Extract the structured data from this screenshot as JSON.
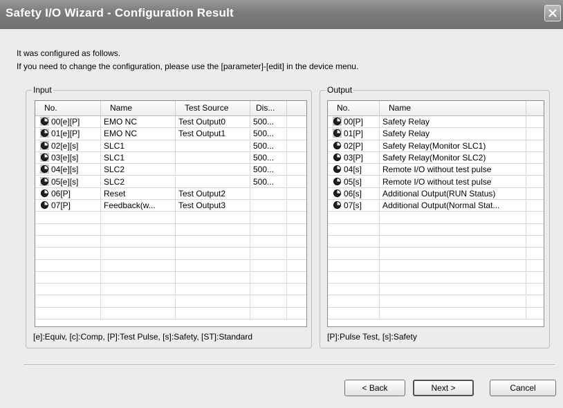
{
  "window": {
    "title": "Safety I/O Wizard - Configuration Result"
  },
  "intro": {
    "line1": "It was configured as follows.",
    "line2": "If you need to change the configuration, please use the [parameter]-[edit] in the device menu."
  },
  "input": {
    "group_label": "Input",
    "columns": [
      "No.",
      "Name",
      "Test Source",
      "Dis..."
    ],
    "rows": [
      {
        "no": "00[e][P]",
        "name": "EMO NC",
        "source": "Test Output0",
        "dis": "500...",
        "icon": "boxed"
      },
      {
        "no": "01[e][P]",
        "name": "EMO NC",
        "source": "Test Output1",
        "dis": "500...",
        "icon": "boxed"
      },
      {
        "no": "02[e][s]",
        "name": "SLC1",
        "source": "",
        "dis": "500...",
        "icon": "boxed"
      },
      {
        "no": "03[e][s]",
        "name": "SLC1",
        "source": "",
        "dis": "500...",
        "icon": "boxed"
      },
      {
        "no": "04[e][s]",
        "name": "SLC2",
        "source": "",
        "dis": "500...",
        "icon": "boxed"
      },
      {
        "no": "05[e][s]",
        "name": "SLC2",
        "source": "",
        "dis": "500...",
        "icon": "boxed"
      },
      {
        "no": "06[P]",
        "name": "Reset",
        "source": "Test Output2",
        "dis": "",
        "icon": "plain"
      },
      {
        "no": "07[P]",
        "name": "Feedback(w...",
        "source": "Test Output3",
        "dis": "",
        "icon": "plain"
      }
    ],
    "legend": "[e]:Equiv, [c]:Comp, [P]:Test Pulse, [s]:Safety, [ST]:Standard"
  },
  "output": {
    "group_label": "Output",
    "columns": [
      "No.",
      "Name"
    ],
    "rows": [
      {
        "no": "00[P]",
        "name": "Safety Relay",
        "icon": "boxed"
      },
      {
        "no": "01[P]",
        "name": "Safety Relay",
        "icon": "boxed"
      },
      {
        "no": "02[P]",
        "name": "Safety Relay(Monitor SLC1)",
        "icon": "plain"
      },
      {
        "no": "03[P]",
        "name": "Safety Relay(Monitor SLC2)",
        "icon": "plain"
      },
      {
        "no": "04[s]",
        "name": "Remote I/O without test pulse",
        "icon": "plain"
      },
      {
        "no": "05[s]",
        "name": "Remote I/O without test pulse",
        "icon": "plain"
      },
      {
        "no": "06[s]",
        "name": "Additional Output(RUN Status)",
        "icon": "plain"
      },
      {
        "no": "07[s]",
        "name": "Additional Output(Normal Stat...",
        "icon": "plain"
      }
    ],
    "legend": "[P]:Pulse Test, [s]:Safety"
  },
  "buttons": {
    "back": "< Back",
    "next": "Next >",
    "cancel": "Cancel"
  },
  "icons": {
    "close": "close-icon",
    "io_point": "io-point-icon"
  },
  "colors": {
    "title_bar": "#7c7c7c",
    "dialog_bg": "#ececec"
  }
}
